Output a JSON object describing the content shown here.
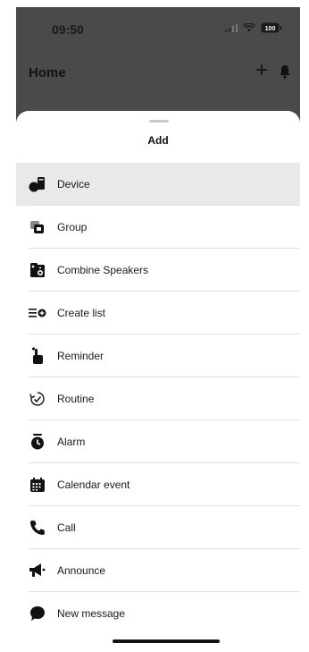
{
  "status_bar": {
    "time": "09:50",
    "battery": "100"
  },
  "header": {
    "title": "Home"
  },
  "sheet": {
    "title": "Add",
    "items": [
      {
        "label": "Device",
        "icon": "device-icon",
        "selected": true
      },
      {
        "label": "Group",
        "icon": "group-icon"
      },
      {
        "label": "Combine Speakers",
        "icon": "speakers-icon"
      },
      {
        "label": "Create list",
        "icon": "list-icon"
      },
      {
        "label": "Reminder",
        "icon": "reminder-icon"
      },
      {
        "label": "Routine",
        "icon": "routine-icon"
      },
      {
        "label": "Alarm",
        "icon": "alarm-icon"
      },
      {
        "label": "Calendar event",
        "icon": "calendar-icon"
      },
      {
        "label": "Call",
        "icon": "phone-icon"
      },
      {
        "label": "Announce",
        "icon": "megaphone-icon"
      },
      {
        "label": "New message",
        "icon": "message-icon"
      }
    ]
  }
}
